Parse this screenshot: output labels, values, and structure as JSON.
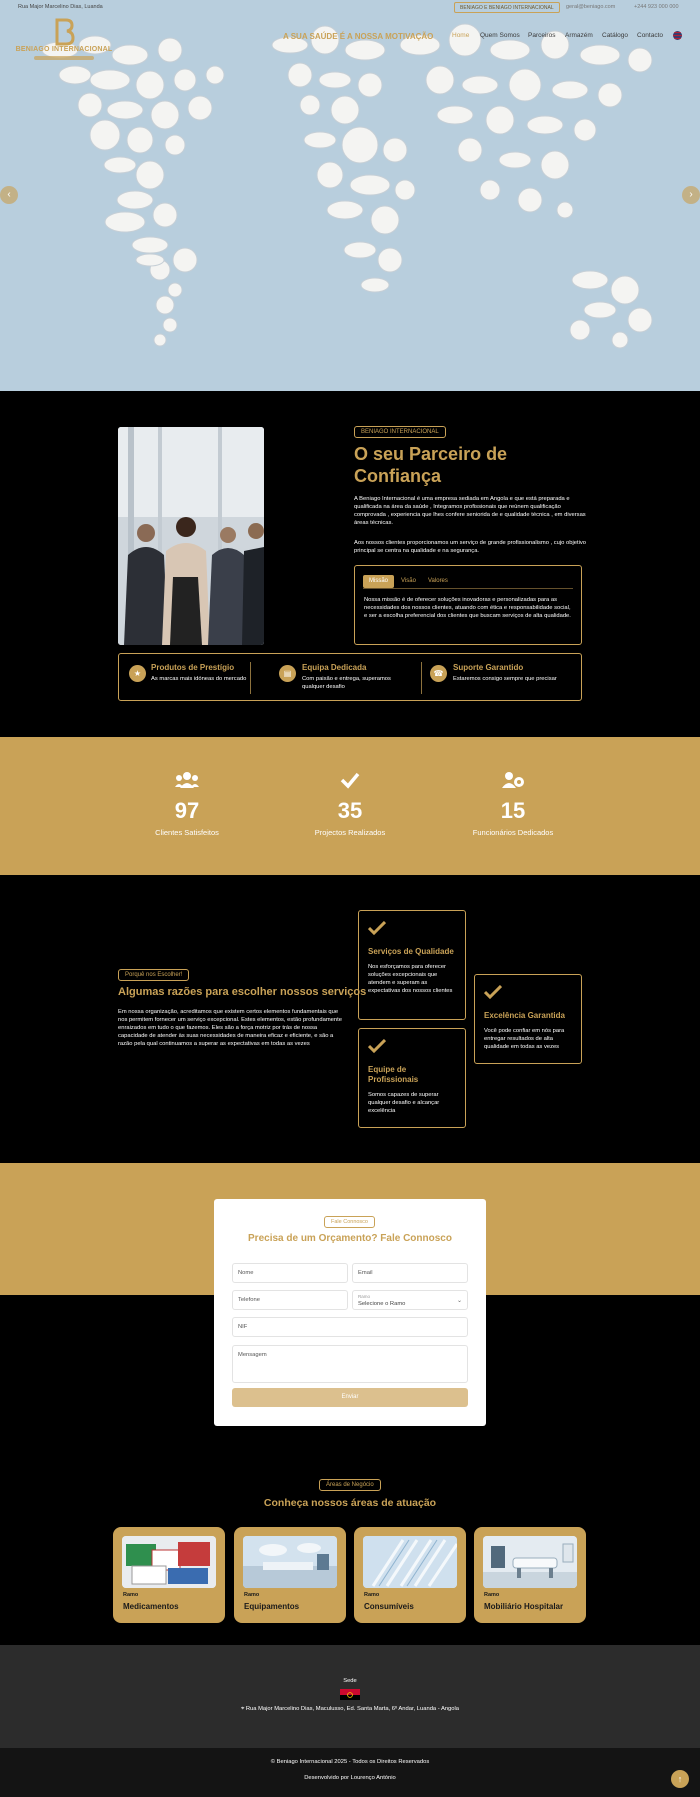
{
  "topbar": {
    "address": "Rua Major Marcelino Dias, Luanda",
    "top_button": "BENIAGO E BENIAGO INTERNACIONAL",
    "email": "geral@beniago.com",
    "phone": "+244 923 000 000"
  },
  "brand": {
    "name": "BENIAGO INTERNACIONAL"
  },
  "header": {
    "slogan": "A SUA SAÚDE É A NOSSA MOTIVAÇÃO",
    "nav": [
      "Home",
      "Quem Somos",
      "Parceiros",
      "Armazém",
      "Catálogo",
      "Contacto"
    ]
  },
  "hero": {
    "prev": "‹",
    "next": "›"
  },
  "about": {
    "label": "BENIAGO INTERNACIONAL",
    "title": "O seu Parceiro de Confiança",
    "p1": "A Beniago Internacional é uma empresa sediada em Angola e que está preparada e qualificada na área da saúde , Integramos profissionais que reúnem qualificação comprovada , experiencia que lhes confere seniorida de e qualidade técnica , em diversas áreas técnicas.",
    "p2": "Aos nossos clientes proporcionamos um serviço de grande profissionalismo , cujo objetivo principal se centra na qualidade e na segurança.",
    "tabs": [
      "Missão",
      "Visão",
      "Valores"
    ],
    "tab_text": "Nossa missão é de oferecer soluções inovadoras e personalizadas para as necessidades dos nossos clientes, atuando com ética e responsabilidade social, e ser a escolha preferencial dos clientes que buscam serviços de alta qualidade."
  },
  "features": [
    {
      "title": "Produtos de Prestígio",
      "desc": "As marcas mais idóneas do mercado",
      "icon": "star-icon"
    },
    {
      "title": "Equipa Dedicada",
      "desc": "Com paixão e entrega, superamos qualquer desafio",
      "icon": "id-card-icon"
    },
    {
      "title": "Suporte Garantido",
      "desc": "Estaremos consigo sempre que precisar",
      "icon": "phone-icon"
    }
  ],
  "stats": [
    {
      "value": "97",
      "label": "Clientes Satisfeitos",
      "icon": "users-icon"
    },
    {
      "value": "35",
      "label": "Projectos Realizados",
      "icon": "check-icon"
    },
    {
      "value": "15",
      "label": "Funcionários Dedicados",
      "icon": "users-gear-icon"
    }
  ],
  "reasons": {
    "label": "Porquê nos Escolher!",
    "title": "Algumas razões para escolher nossos serviços",
    "text": "Em nossa organização, acreditamos que existem certos elementos fundamentais que nos permitem fornecer um serviço excepcional. Estes elementos, estão profundamente enraizados em tudo o que fazemos. Eles são a força motriz por trás de nossa capacidade de atender às suas necessidades de maneira eficaz e eficiente, e são a razão pela qual continuamos a superar as expectativas em todas as vezes",
    "cards": [
      {
        "title": "Serviços de Qualidade",
        "desc": "Nos esforçamos para oferecer soluções excepcionais que atendem e superam as expectativas dos nossos clientes"
      },
      {
        "title": "Equipe de Profissionais",
        "desc": "Somos capazes de superar qualquer desafio e alcançar excelência"
      },
      {
        "title": "Excelência Garantida",
        "desc": "Você pode confiar em nós para entregar resultados de alta qualidade em todas as vezes"
      }
    ]
  },
  "contact": {
    "label": "Fale Connosco",
    "title": "Precisa de um Orçamento? Fale Connosco",
    "nome": "Nome",
    "email": "Email",
    "telefone": "Telefone",
    "ramo_small": "Ramo",
    "ramo_value": "Selecione o Ramo",
    "nif": "NIF",
    "mensagem": "Mensagem",
    "submit": "Enviar"
  },
  "areas": {
    "label": "Áreas de Negócio",
    "title": "Conheça nossos áreas de atuação",
    "ramo": "Ramo",
    "items": [
      "Medicamentos",
      "Equipamentos",
      "Consumíveis",
      "Mobiliário Hospitalar"
    ]
  },
  "footer": {
    "sede": "Sede",
    "address": "Rua Major Marcelino Dias, Maculusso, Ed. Santa Marta, 6º Andar, Luanda - Angola",
    "copyright": "© Beniago Internacional 2025 - Todos os Direitos Reservados",
    "developer": "Desenvolvido por Lourenço António",
    "to_top": "↑"
  },
  "colors": {
    "accent": "#c9a257",
    "background": "#000000",
    "footer": "#2c2c2c"
  }
}
